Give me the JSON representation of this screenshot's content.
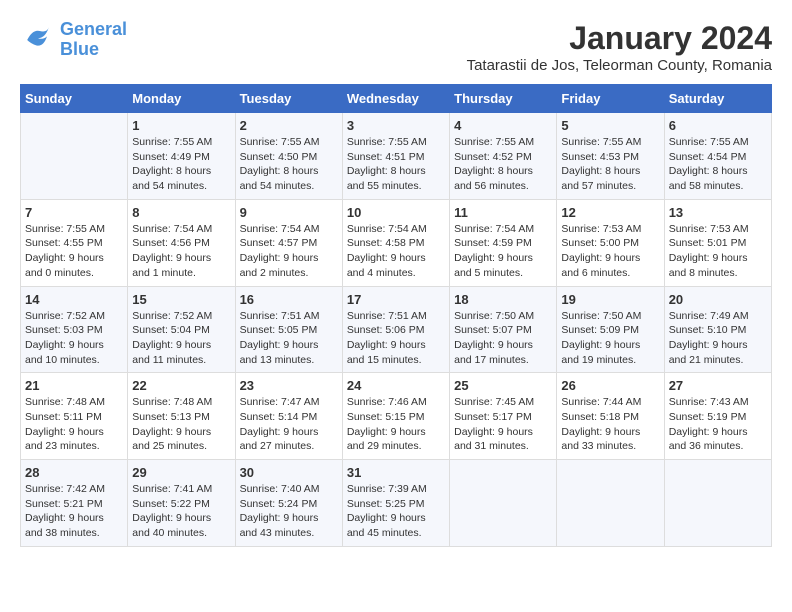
{
  "header": {
    "logo_line1": "General",
    "logo_line2": "Blue",
    "month_year": "January 2024",
    "location": "Tatarastii de Jos, Teleorman County, Romania"
  },
  "weekdays": [
    "Sunday",
    "Monday",
    "Tuesday",
    "Wednesday",
    "Thursday",
    "Friday",
    "Saturday"
  ],
  "weeks": [
    [
      {
        "day": "",
        "sunrise": "",
        "sunset": "",
        "daylight": ""
      },
      {
        "day": "1",
        "sunrise": "Sunrise: 7:55 AM",
        "sunset": "Sunset: 4:49 PM",
        "daylight": "Daylight: 8 hours and 54 minutes."
      },
      {
        "day": "2",
        "sunrise": "Sunrise: 7:55 AM",
        "sunset": "Sunset: 4:50 PM",
        "daylight": "Daylight: 8 hours and 54 minutes."
      },
      {
        "day": "3",
        "sunrise": "Sunrise: 7:55 AM",
        "sunset": "Sunset: 4:51 PM",
        "daylight": "Daylight: 8 hours and 55 minutes."
      },
      {
        "day": "4",
        "sunrise": "Sunrise: 7:55 AM",
        "sunset": "Sunset: 4:52 PM",
        "daylight": "Daylight: 8 hours and 56 minutes."
      },
      {
        "day": "5",
        "sunrise": "Sunrise: 7:55 AM",
        "sunset": "Sunset: 4:53 PM",
        "daylight": "Daylight: 8 hours and 57 minutes."
      },
      {
        "day": "6",
        "sunrise": "Sunrise: 7:55 AM",
        "sunset": "Sunset: 4:54 PM",
        "daylight": "Daylight: 8 hours and 58 minutes."
      }
    ],
    [
      {
        "day": "7",
        "sunrise": "Sunrise: 7:55 AM",
        "sunset": "Sunset: 4:55 PM",
        "daylight": "Daylight: 9 hours and 0 minutes."
      },
      {
        "day": "8",
        "sunrise": "Sunrise: 7:54 AM",
        "sunset": "Sunset: 4:56 PM",
        "daylight": "Daylight: 9 hours and 1 minute."
      },
      {
        "day": "9",
        "sunrise": "Sunrise: 7:54 AM",
        "sunset": "Sunset: 4:57 PM",
        "daylight": "Daylight: 9 hours and 2 minutes."
      },
      {
        "day": "10",
        "sunrise": "Sunrise: 7:54 AM",
        "sunset": "Sunset: 4:58 PM",
        "daylight": "Daylight: 9 hours and 4 minutes."
      },
      {
        "day": "11",
        "sunrise": "Sunrise: 7:54 AM",
        "sunset": "Sunset: 4:59 PM",
        "daylight": "Daylight: 9 hours and 5 minutes."
      },
      {
        "day": "12",
        "sunrise": "Sunrise: 7:53 AM",
        "sunset": "Sunset: 5:00 PM",
        "daylight": "Daylight: 9 hours and 6 minutes."
      },
      {
        "day": "13",
        "sunrise": "Sunrise: 7:53 AM",
        "sunset": "Sunset: 5:01 PM",
        "daylight": "Daylight: 9 hours and 8 minutes."
      }
    ],
    [
      {
        "day": "14",
        "sunrise": "Sunrise: 7:52 AM",
        "sunset": "Sunset: 5:03 PM",
        "daylight": "Daylight: 9 hours and 10 minutes."
      },
      {
        "day": "15",
        "sunrise": "Sunrise: 7:52 AM",
        "sunset": "Sunset: 5:04 PM",
        "daylight": "Daylight: 9 hours and 11 minutes."
      },
      {
        "day": "16",
        "sunrise": "Sunrise: 7:51 AM",
        "sunset": "Sunset: 5:05 PM",
        "daylight": "Daylight: 9 hours and 13 minutes."
      },
      {
        "day": "17",
        "sunrise": "Sunrise: 7:51 AM",
        "sunset": "Sunset: 5:06 PM",
        "daylight": "Daylight: 9 hours and 15 minutes."
      },
      {
        "day": "18",
        "sunrise": "Sunrise: 7:50 AM",
        "sunset": "Sunset: 5:07 PM",
        "daylight": "Daylight: 9 hours and 17 minutes."
      },
      {
        "day": "19",
        "sunrise": "Sunrise: 7:50 AM",
        "sunset": "Sunset: 5:09 PM",
        "daylight": "Daylight: 9 hours and 19 minutes."
      },
      {
        "day": "20",
        "sunrise": "Sunrise: 7:49 AM",
        "sunset": "Sunset: 5:10 PM",
        "daylight": "Daylight: 9 hours and 21 minutes."
      }
    ],
    [
      {
        "day": "21",
        "sunrise": "Sunrise: 7:48 AM",
        "sunset": "Sunset: 5:11 PM",
        "daylight": "Daylight: 9 hours and 23 minutes."
      },
      {
        "day": "22",
        "sunrise": "Sunrise: 7:48 AM",
        "sunset": "Sunset: 5:13 PM",
        "daylight": "Daylight: 9 hours and 25 minutes."
      },
      {
        "day": "23",
        "sunrise": "Sunrise: 7:47 AM",
        "sunset": "Sunset: 5:14 PM",
        "daylight": "Daylight: 9 hours and 27 minutes."
      },
      {
        "day": "24",
        "sunrise": "Sunrise: 7:46 AM",
        "sunset": "Sunset: 5:15 PM",
        "daylight": "Daylight: 9 hours and 29 minutes."
      },
      {
        "day": "25",
        "sunrise": "Sunrise: 7:45 AM",
        "sunset": "Sunset: 5:17 PM",
        "daylight": "Daylight: 9 hours and 31 minutes."
      },
      {
        "day": "26",
        "sunrise": "Sunrise: 7:44 AM",
        "sunset": "Sunset: 5:18 PM",
        "daylight": "Daylight: 9 hours and 33 minutes."
      },
      {
        "day": "27",
        "sunrise": "Sunrise: 7:43 AM",
        "sunset": "Sunset: 5:19 PM",
        "daylight": "Daylight: 9 hours and 36 minutes."
      }
    ],
    [
      {
        "day": "28",
        "sunrise": "Sunrise: 7:42 AM",
        "sunset": "Sunset: 5:21 PM",
        "daylight": "Daylight: 9 hours and 38 minutes."
      },
      {
        "day": "29",
        "sunrise": "Sunrise: 7:41 AM",
        "sunset": "Sunset: 5:22 PM",
        "daylight": "Daylight: 9 hours and 40 minutes."
      },
      {
        "day": "30",
        "sunrise": "Sunrise: 7:40 AM",
        "sunset": "Sunset: 5:24 PM",
        "daylight": "Daylight: 9 hours and 43 minutes."
      },
      {
        "day": "31",
        "sunrise": "Sunrise: 7:39 AM",
        "sunset": "Sunset: 5:25 PM",
        "daylight": "Daylight: 9 hours and 45 minutes."
      },
      {
        "day": "",
        "sunrise": "",
        "sunset": "",
        "daylight": ""
      },
      {
        "day": "",
        "sunrise": "",
        "sunset": "",
        "daylight": ""
      },
      {
        "day": "",
        "sunrise": "",
        "sunset": "",
        "daylight": ""
      }
    ]
  ]
}
